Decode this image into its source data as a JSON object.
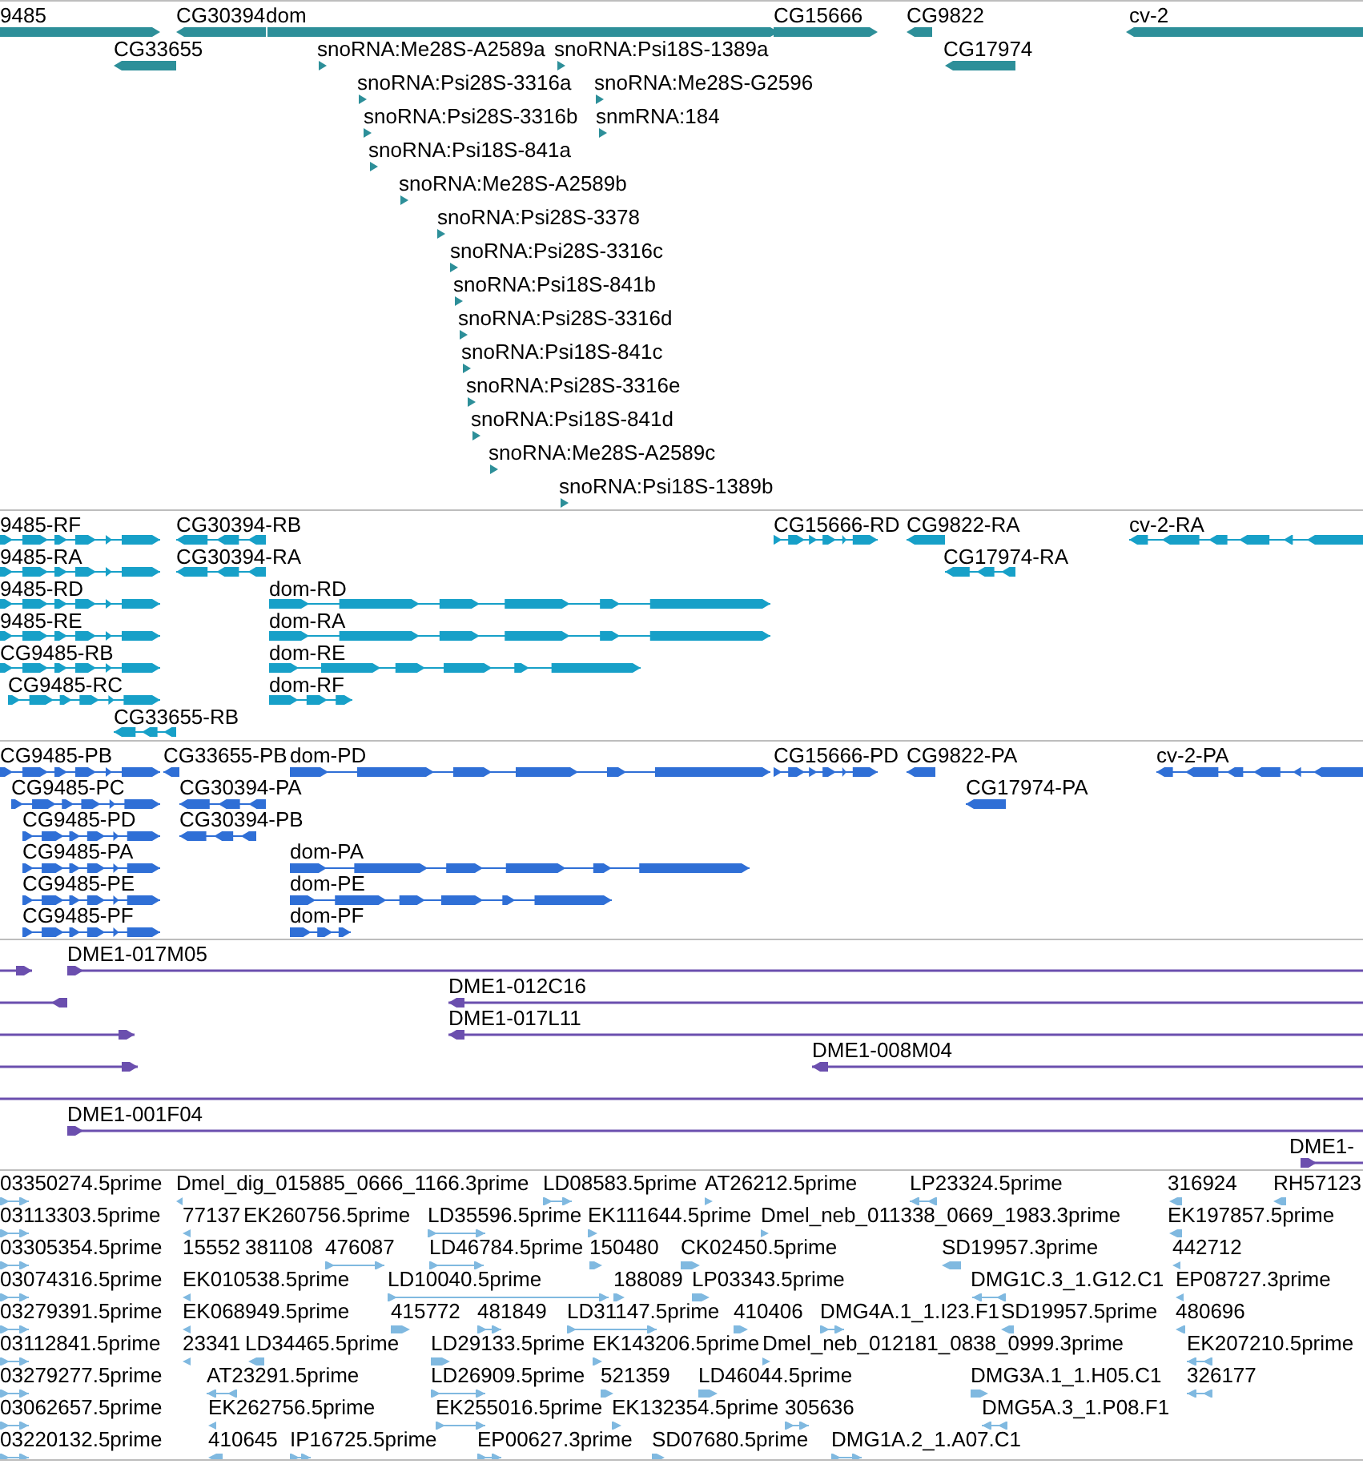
{
  "tracks": [
    {
      "kind": "gene",
      "features": [
        {
          "label": "9485",
          "forward": true
        },
        {
          "label": "CG30394",
          "forward": false
        },
        {
          "label": "dom",
          "forward": true
        },
        {
          "label": "CG15666",
          "forward": true
        },
        {
          "label": "CG9822",
          "forward": false
        },
        {
          "label": "cv-2",
          "forward": false
        },
        {
          "label": "CG33655",
          "forward": false
        },
        {
          "label": "snoRNA:Me28S-A2589a",
          "forward": true
        },
        {
          "label": "snoRNA:Psi18S-1389a",
          "forward": true
        },
        {
          "label": "CG17974",
          "forward": false
        },
        {
          "label": "snoRNA:Psi28S-3316a",
          "forward": true
        },
        {
          "label": "snoRNA:Me28S-G2596",
          "forward": true
        },
        {
          "label": "snoRNA:Psi28S-3316b",
          "forward": true
        },
        {
          "label": "snmRNA:184",
          "forward": true
        },
        {
          "label": "snoRNA:Psi18S-841a",
          "forward": true
        },
        {
          "label": "snoRNA:Me28S-A2589b",
          "forward": true
        },
        {
          "label": "snoRNA:Psi28S-3378",
          "forward": true
        },
        {
          "label": "snoRNA:Psi28S-3316c",
          "forward": true
        },
        {
          "label": "snoRNA:Psi18S-841b",
          "forward": true
        },
        {
          "label": "snoRNA:Psi28S-3316d",
          "forward": true
        },
        {
          "label": "snoRNA:Psi18S-841c",
          "forward": true
        },
        {
          "label": "snoRNA:Psi28S-3316e",
          "forward": true
        },
        {
          "label": "snoRNA:Psi18S-841d",
          "forward": true
        },
        {
          "label": "snoRNA:Me28S-A2589c",
          "forward": true
        },
        {
          "label": "snoRNA:Psi18S-1389b",
          "forward": true
        }
      ]
    },
    {
      "kind": "transcript",
      "features": [
        {
          "label": "9485-RF",
          "forward": true
        },
        {
          "label": "CG30394-RB",
          "forward": false
        },
        {
          "label": "CG15666-RD",
          "forward": true
        },
        {
          "label": "CG9822-RA",
          "forward": false
        },
        {
          "label": "cv-2-RA",
          "forward": false
        },
        {
          "label": "9485-RA",
          "forward": true
        },
        {
          "label": "CG30394-RA",
          "forward": false
        },
        {
          "label": "CG17974-RA",
          "forward": false
        },
        {
          "label": "9485-RD",
          "forward": true
        },
        {
          "label": "dom-RD",
          "forward": true
        },
        {
          "label": "9485-RE",
          "forward": true
        },
        {
          "label": "dom-RA",
          "forward": true
        },
        {
          "label": "CG9485-RB",
          "forward": true
        },
        {
          "label": "dom-RE",
          "forward": true
        },
        {
          "label": "CG9485-RC",
          "forward": true
        },
        {
          "label": "dom-RF",
          "forward": true
        },
        {
          "label": "CG33655-RB",
          "forward": false
        }
      ]
    },
    {
      "kind": "protein",
      "features": [
        {
          "label": "CG9485-PB",
          "forward": true
        },
        {
          "label": "CG33655-PB",
          "forward": false
        },
        {
          "label": "dom-PD",
          "forward": true
        },
        {
          "label": "CG15666-PD",
          "forward": true
        },
        {
          "label": "CG9822-PA",
          "forward": false
        },
        {
          "label": "cv-2-PA",
          "forward": false
        },
        {
          "label": "CG9485-PC",
          "forward": true
        },
        {
          "label": "CG30394-PA",
          "forward": false
        },
        {
          "label": "CG17974-PA",
          "forward": false
        },
        {
          "label": "CG9485-PD",
          "forward": true
        },
        {
          "label": "CG30394-PB",
          "forward": false
        },
        {
          "label": "CG9485-PA",
          "forward": true
        },
        {
          "label": "dom-PA",
          "forward": true
        },
        {
          "label": "CG9485-PE",
          "forward": true
        },
        {
          "label": "dom-PE",
          "forward": true
        },
        {
          "label": "CG9485-PF",
          "forward": true
        },
        {
          "label": "dom-PF",
          "forward": true
        }
      ]
    },
    {
      "kind": "clone",
      "features": [
        {
          "kind": "arrow",
          "forward": true
        },
        {
          "kind": "arrow",
          "label": "DME1-017M05",
          "forward": true
        },
        {
          "kind": "arrow",
          "forward": false
        },
        {
          "kind": "arrow",
          "label": "DME1-012C16",
          "forward": false
        },
        {
          "kind": "arrow",
          "forward": true
        },
        {
          "kind": "arrow",
          "label": "DME1-017L11",
          "forward": false
        },
        {
          "kind": "arrow",
          "forward": true
        },
        {
          "kind": "arrow",
          "label": "DME1-008M04",
          "forward": false
        },
        {
          "kind": "line"
        },
        {
          "kind": "arrow",
          "label": "DME1-001F04",
          "forward": true
        },
        {
          "kind": "arrow",
          "label": "DME1-",
          "forward": true
        }
      ]
    },
    {
      "kind": "est",
      "features": [
        {
          "label": "03350274.5prime",
          "forward": true
        },
        {
          "label": "Dmel_dig_015885_0666_1166.3prime",
          "forward": false
        },
        {
          "label": "LD08583.5prime",
          "forward": true
        },
        {
          "label": "AT26212.5prime",
          "forward": true
        },
        {
          "label": "LP23324.5prime",
          "forward": false
        },
        {
          "label": "316924",
          "forward": false
        },
        {
          "label": "RH57123",
          "forward": false
        },
        {
          "label": "03113303.5prime",
          "forward": true
        },
        {
          "label": "77137",
          "forward": false
        },
        {
          "label": "EK260756.5prime"
        },
        {
          "label": "LD35596.5prime",
          "forward": true
        },
        {
          "label": "EK111644.5prime",
          "forward": true
        },
        {
          "label": "Dmel_neb_011338_0669_1983.3prime",
          "forward": true
        },
        {
          "label": "EK197857.5prime",
          "forward": false
        },
        {
          "label": "03305354.5prime",
          "forward": true
        },
        {
          "label": "15552"
        },
        {
          "label": "381108"
        },
        {
          "label": "476087",
          "forward": true
        },
        {
          "label": "LD46784.5prime",
          "forward": true
        },
        {
          "label": "150480",
          "forward": true
        },
        {
          "label": "CK02450.5prime",
          "forward": true
        },
        {
          "label": "SD19957.3prime",
          "forward": false
        },
        {
          "label": "442712",
          "forward": false
        },
        {
          "label": "03074316.5prime",
          "forward": true
        },
        {
          "label": "EK010538.5prime",
          "forward": false
        },
        {
          "label": "LD10040.5prime",
          "forward": true
        },
        {
          "label": "188089",
          "forward": true
        },
        {
          "label": "LP03343.5prime",
          "forward": true
        },
        {
          "label": "DMG1C.3_1.G12.C1",
          "forward": false
        },
        {
          "label": "EP08727.3prime",
          "forward": false
        },
        {
          "label": "03279391.5prime",
          "forward": true
        },
        {
          "label": "EK068949.5prime",
          "forward": false
        },
        {
          "label": "415772",
          "forward": true
        },
        {
          "label": "481849",
          "forward": true
        },
        {
          "label": "LD31147.5prime",
          "forward": true
        },
        {
          "label": "410406",
          "forward": true
        },
        {
          "label": "DMG4A.1_1.I23.F1",
          "forward": true
        },
        {
          "label": "SD19957.5prime",
          "forward": false
        },
        {
          "label": "480696",
          "forward": false
        },
        {
          "label": "03112841.5prime",
          "forward": true
        },
        {
          "label": "23341",
          "forward": false
        },
        {
          "label": "LD34465.5prime",
          "forward": false
        },
        {
          "label": "LD29133.5prime",
          "forward": true
        },
        {
          "label": "EK143206.5prime",
          "forward": true
        },
        {
          "label": "Dmel_neb_012181_0838_0999.3prime",
          "forward": true
        },
        {
          "label": "EK207210.5prime",
          "forward": false
        },
        {
          "label": "03279277.5prime",
          "forward": true
        },
        {
          "label": "AT23291.5prime",
          "forward": false
        },
        {
          "label": "LD26909.5prime",
          "forward": true
        },
        {
          "label": "521359",
          "forward": true
        },
        {
          "label": "LD46044.5prime",
          "forward": true
        },
        {
          "label": "DMG3A.1_1.H05.C1",
          "forward": true
        },
        {
          "label": "326177",
          "forward": false
        },
        {
          "label": "03062657.5prime",
          "forward": true
        },
        {
          "label": "EK262756.5prime",
          "forward": false
        },
        {
          "label": "EK255016.5prime",
          "forward": true
        },
        {
          "label": "EK132354.5prime",
          "forward": true
        },
        {
          "label": "305636",
          "forward": true
        },
        {
          "label": "DMG5A.3_1.P08.F1",
          "forward": false
        },
        {
          "label": "03220132.5prime",
          "forward": true
        },
        {
          "label": "410645",
          "forward": false
        },
        {
          "label": "IP16725.5prime",
          "forward": true
        },
        {
          "label": "EP00627.3prime",
          "forward": true
        },
        {
          "label": "SD07680.5prime",
          "forward": true
        },
        {
          "label": "DMG1A.2_1.A07.C1",
          "forward": true
        }
      ]
    }
  ]
}
